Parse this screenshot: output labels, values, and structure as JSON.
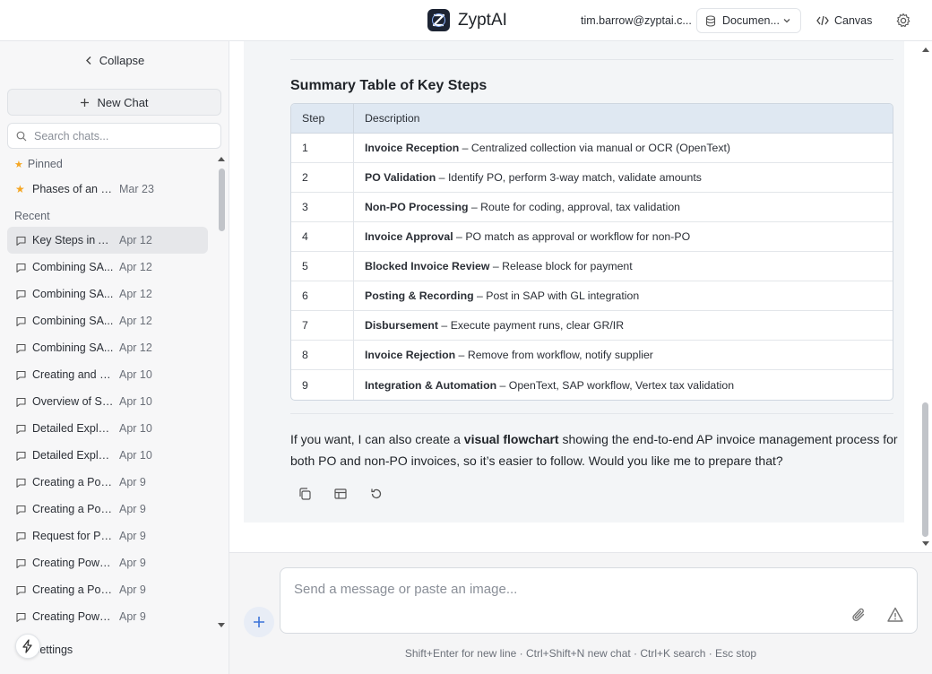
{
  "header": {
    "app_name": "ZyptAI",
    "user_email": "tim.barrow@zyptai.c...",
    "doc_selector": "Documen...",
    "canvas_label": "Canvas"
  },
  "sidebar": {
    "collapse_label": "Collapse",
    "new_chat_label": "New Chat",
    "search_placeholder": "Search chats...",
    "pinned_label": "Pinned",
    "pinned": [
      {
        "title": "Phases of an S...",
        "date": "Mar 23"
      }
    ],
    "recent_label": "Recent",
    "recent": [
      {
        "title": "Key Steps in AP...",
        "date": "Apr 12",
        "active": true
      },
      {
        "title": "Combining SA...",
        "date": "Apr 12"
      },
      {
        "title": "Combining SA...",
        "date": "Apr 12"
      },
      {
        "title": "Combining SA...",
        "date": "Apr 12"
      },
      {
        "title": "Combining SA...",
        "date": "Apr 12"
      },
      {
        "title": "Creating and E...",
        "date": "Apr 10"
      },
      {
        "title": "Overview of SA...",
        "date": "Apr 10"
      },
      {
        "title": "Detailed Explan...",
        "date": "Apr 10"
      },
      {
        "title": "Detailed Explan...",
        "date": "Apr 10"
      },
      {
        "title": "Creating a Powe...",
        "date": "Apr 9"
      },
      {
        "title": "Creating a Powe...",
        "date": "Apr 9"
      },
      {
        "title": "Request for Pow...",
        "date": "Apr 9"
      },
      {
        "title": "Creating PowerP...",
        "date": "Apr 9"
      },
      {
        "title": "Creating a Powe...",
        "date": "Apr 9"
      },
      {
        "title": "Creating PowerP...",
        "date": "Apr 9"
      }
    ],
    "settings_label": "Settings"
  },
  "message": {
    "summary_title": "Summary Table of Key Steps",
    "table": {
      "headers": [
        "Step",
        "Description"
      ],
      "rows": [
        {
          "step": "1",
          "bold": "Invoice Reception",
          "text": " – Centralized collection via manual or OCR (OpenText)"
        },
        {
          "step": "2",
          "bold": "PO Validation",
          "text": " – Identify PO, perform 3-way match, validate amounts"
        },
        {
          "step": "3",
          "bold": "Non-PO Processing",
          "text": " – Route for coding, approval, tax validation"
        },
        {
          "step": "4",
          "bold": "Invoice Approval",
          "text": " – PO match as approval or workflow for non-PO"
        },
        {
          "step": "5",
          "bold": "Blocked Invoice Review",
          "text": " – Release block for payment"
        },
        {
          "step": "6",
          "bold": "Posting & Recording",
          "text": " – Post in SAP with GL integration"
        },
        {
          "step": "7",
          "bold": "Disbursement",
          "text": " – Execute payment runs, clear GR/IR"
        },
        {
          "step": "8",
          "bold": "Invoice Rejection",
          "text": " – Remove from workflow, notify supplier"
        },
        {
          "step": "9",
          "bold": "Integration & Automation",
          "text": " – OpenText, SAP workflow, Vertex tax validation"
        }
      ]
    },
    "para_pre": "If you want, I can also create a ",
    "para_bold": "visual flowchart",
    "para_post": " showing the end-to-end AP invoice management process for both PO and non-PO invoices, so it’s easier to follow. Would you like me to prepare that?"
  },
  "composer": {
    "placeholder": "Send a message or paste an image...",
    "hint": "Shift+Enter for new line · Ctrl+Shift+N new chat · Ctrl+K search · Esc stop"
  },
  "colors": {
    "accent": "#f5a623",
    "table_header_bg": "#dfe8f2",
    "card_bg": "#f3f5f7"
  }
}
